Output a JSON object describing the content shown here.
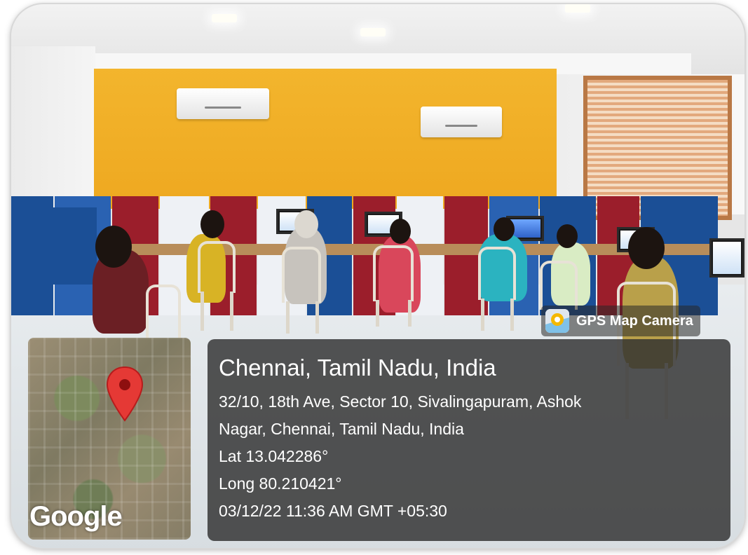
{
  "badge": {
    "app_name": "GPS Map Camera",
    "icon": "gps-map-camera-app-icon"
  },
  "location": {
    "title": "Chennai, Tamil Nadu, India",
    "address_line1": "32/10, 18th Ave, Sector 10, Sivalingapuram, Ashok",
    "address_line2": "Nagar, Chennai, Tamil Nadu, India",
    "latitude": "Lat 13.042286°",
    "longitude": "Long 80.210421°",
    "timestamp": "03/12/22 11:36 AM GMT +05:30"
  },
  "map": {
    "logo_text": "Google",
    "pin_icon": "map-pin-icon",
    "pin_color": "#e53935"
  },
  "colors": {
    "overlay": "#303030",
    "wall_accent": "#f0ac24",
    "partition_blue": "#1b4f96",
    "partition_red": "#9b1e2b"
  }
}
